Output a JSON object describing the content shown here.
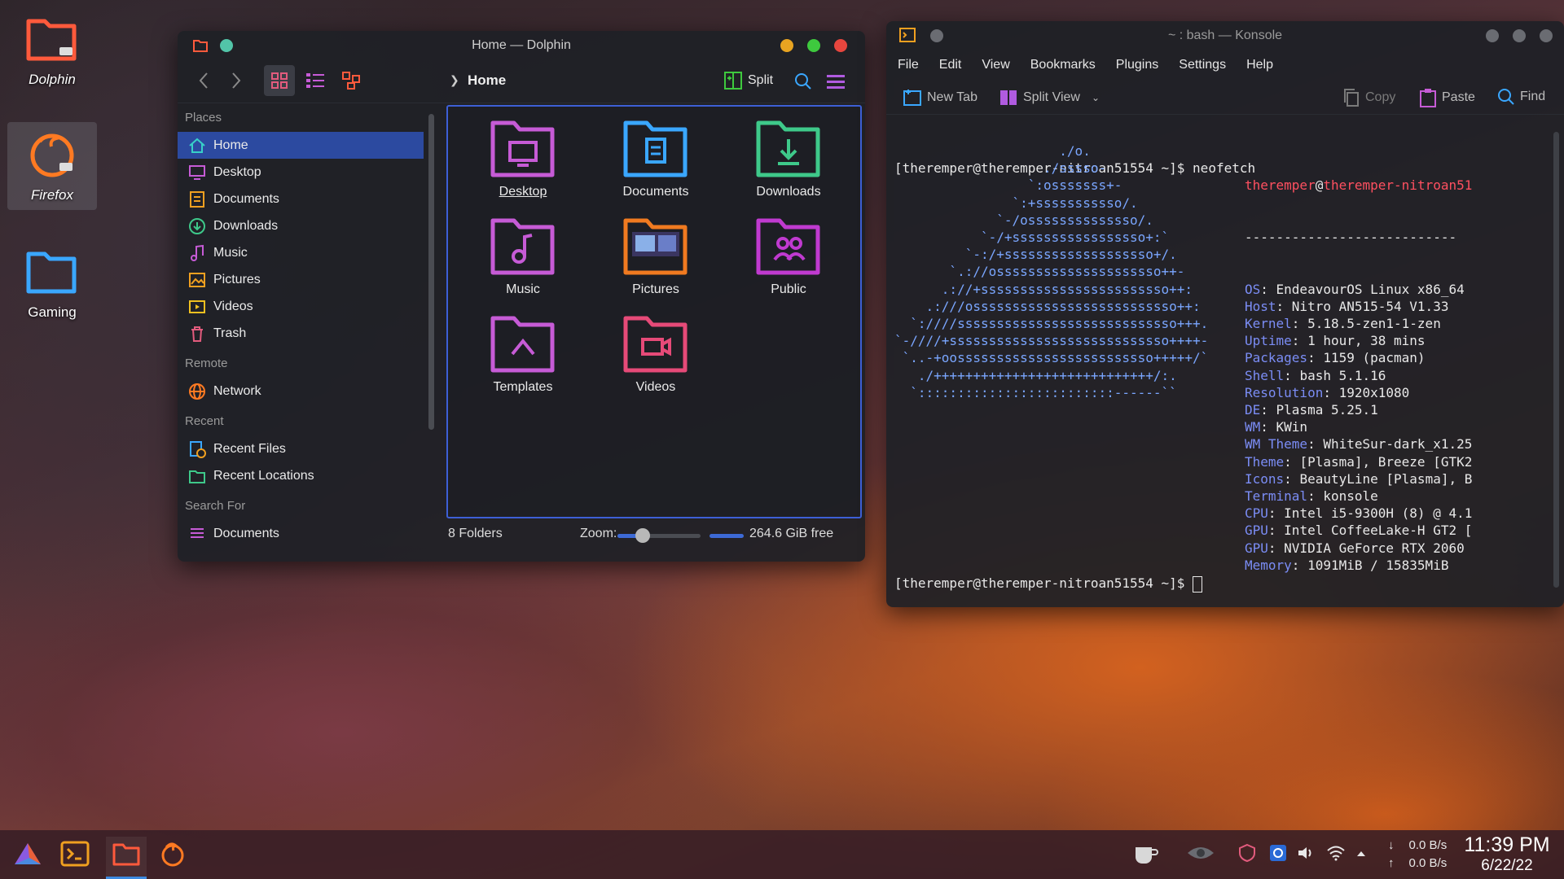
{
  "desktop": {
    "icons": [
      {
        "label": "Dolphin"
      },
      {
        "label": "Firefox"
      },
      {
        "label": "Gaming"
      }
    ]
  },
  "dolphin": {
    "title": "Home — Dolphin",
    "breadcrumb": "Home",
    "split_label": "Split",
    "places_header": "Places",
    "places": [
      "Home",
      "Desktop",
      "Documents",
      "Downloads",
      "Music",
      "Pictures",
      "Videos",
      "Trash"
    ],
    "remote_header": "Remote",
    "remote": [
      "Network"
    ],
    "recent_header": "Recent",
    "recent": [
      "Recent Files",
      "Recent Locations"
    ],
    "search_header": "Search For",
    "search": [
      "Documents"
    ],
    "folders": [
      "Desktop",
      "Documents",
      "Downloads",
      "Music",
      "Pictures",
      "Public",
      "Templates",
      "Videos"
    ],
    "status_count": "8 Folders",
    "zoom_label": "Zoom:",
    "free_space": "264.6 GiB free"
  },
  "konsole": {
    "title": "~ : bash — Konsole",
    "menu": [
      "File",
      "Edit",
      "View",
      "Bookmarks",
      "Plugins",
      "Settings",
      "Help"
    ],
    "toolbar": {
      "new_tab": "New Tab",
      "split_view": "Split View",
      "copy": "Copy",
      "paste": "Paste",
      "find": "Find"
    },
    "prompt1": "[theremper@theremper-nitroan51554 ~]$ neofetch",
    "logo_lines": [
      "                     ./o.",
      "                   ./sssso-",
      "                 `:osssssss+-",
      "               `:+sssssssssso/.",
      "             `-/ossssssssssssso/.",
      "           `-/+sssssssssssssssso+:`",
      "         `-:/+sssssssssssssssssso+/.",
      "       `.://osssssssssssssssssssso++-",
      "      .://+ssssssssssssssssssssssso++:",
      "    .:///ossssssssssssssssssssssssso++:",
      "  `:////ssssssssssssssssssssssssssso+++.",
      "`-////+ssssssssssssssssssssssssssso++++-",
      " `..-+oosssssssssssssssssssssssso+++++/`",
      "   ./++++++++++++++++++++++++++++/:.",
      "  `:::::::::::::::::::::::::------``"
    ],
    "user": "theremper",
    "at": "@",
    "host": "theremper-nitroan51",
    "separator": "---------------------------",
    "info": [
      {
        "k": "OS",
        "v": ": EndeavourOS Linux x86_64"
      },
      {
        "k": "Host",
        "v": ": Nitro AN515-54 V1.33"
      },
      {
        "k": "Kernel",
        "v": ": 5.18.5-zen1-1-zen"
      },
      {
        "k": "Uptime",
        "v": ": 1 hour, 38 mins"
      },
      {
        "k": "Packages",
        "v": ": 1159 (pacman)"
      },
      {
        "k": "Shell",
        "v": ": bash 5.1.16"
      },
      {
        "k": "Resolution",
        "v": ": 1920x1080"
      },
      {
        "k": "DE",
        "v": ": Plasma 5.25.1"
      },
      {
        "k": "WM",
        "v": ": KWin"
      },
      {
        "k": "WM Theme",
        "v": ": WhiteSur-dark_x1.25"
      },
      {
        "k": "Theme",
        "v": ": [Plasma], Breeze [GTK2"
      },
      {
        "k": "Icons",
        "v": ": BeautyLine [Plasma], B"
      },
      {
        "k": "Terminal",
        "v": ": konsole"
      },
      {
        "k": "CPU",
        "v": ": Intel i5-9300H (8) @ 4.1"
      },
      {
        "k": "GPU",
        "v": ": Intel CoffeeLake-H GT2 ["
      },
      {
        "k": "GPU",
        "v": ": NVIDIA GeForce RTX 2060"
      },
      {
        "k": "Memory",
        "v": ": 1091MiB / 15835MiB"
      }
    ],
    "palette_top": [
      "#1f2126",
      "#e8302e",
      "#2fd05a",
      "#f08a1e",
      "#3a97e0",
      "#8a54c2",
      "#18b59a",
      "#f4f4f4"
    ],
    "palette_bottom": [
      "#808080",
      "#d03a30",
      "#38e07a",
      "#f5b042",
      "#53b0ec",
      "#9b62d2",
      "#1aa88a",
      "#ffffff"
    ],
    "prompt2": "[theremper@theremper-nitroan51554 ~]$ "
  },
  "taskbar": {
    "net_down": "0.0 B/s",
    "net_up": "0.0 B/s",
    "time": "11:39 PM",
    "date": "6/22/22"
  }
}
